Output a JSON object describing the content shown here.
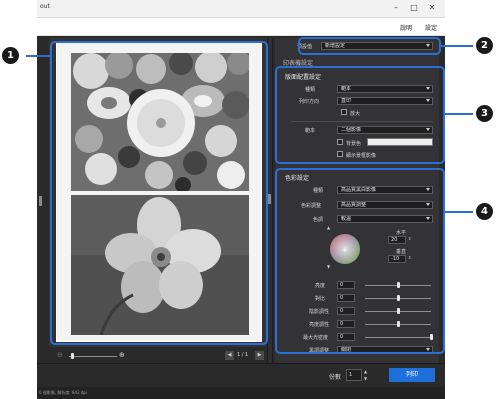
{
  "window": {
    "title": "out"
  },
  "menubar": {
    "items": [
      "說明",
      "設定"
    ]
  },
  "preview": {
    "page_counter": "1 / 1"
  },
  "side": {
    "preset_label": "預設值",
    "preset_value": "新增設定",
    "print_settings_header": "印表機設定",
    "layout": {
      "header": "版面配置設定",
      "type_label": "種類",
      "type_value": "範本",
      "orientation_label": "列印方向",
      "orientation_value": "直印",
      "enlarge_label": "放大",
      "template_label": "範本",
      "template_value": "二個影像",
      "bgcolor_label": "背景色",
      "show_frame_label": "顯示景框影像"
    },
    "color": {
      "header": "色彩設定",
      "type_label": "種類",
      "type_value": "高品質黑白影像",
      "adjust_label": "色彩調整",
      "adjust_value": "高品質調整",
      "tone_label": "色調",
      "tone_value": "較溫",
      "horizontal_label": "水平",
      "horizontal_value": "20",
      "vertical_label": "垂直",
      "vertical_value": "-10",
      "brightness_label": "亮度",
      "brightness_value": "0",
      "contrast_label": "對比",
      "contrast_value": "0",
      "shadow_label": "陰影調性",
      "shadow_value": "0",
      "highlight_label": "亮度調性",
      "highlight_value": "0",
      "max_density_label": "最大光密度",
      "max_density_value": "0",
      "tone_option_label": "黑調調整",
      "tone_option_value": "關閉"
    }
  },
  "bottom": {
    "copies_label": "份數",
    "copies_value": "1",
    "print_label": "列印",
    "status": "0 個影像, 解析度: 842 dpi"
  },
  "callouts": [
    "1",
    "2",
    "3",
    "4"
  ],
  "accent": "#2b6fd6"
}
